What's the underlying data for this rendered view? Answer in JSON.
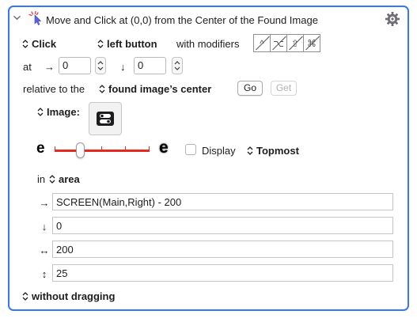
{
  "action": {
    "title": "Move and Click at (0,0) from the Center of the Found Image"
  },
  "click": {
    "type": "Click",
    "button": "left button",
    "modifiers_label": "with modifiers",
    "modifiers": [
      {
        "name": "control",
        "glyph": "^"
      },
      {
        "name": "option",
        "glyph": "⌥"
      },
      {
        "name": "shift",
        "glyph": "⇧"
      },
      {
        "name": "command",
        "glyph": "⌘"
      }
    ]
  },
  "position": {
    "at_label": "at",
    "x_arrow": "→",
    "x_value": "0",
    "y_arrow": "↓",
    "y_value": "0"
  },
  "relative": {
    "label": "relative to the",
    "anchor": "found image’s center",
    "go_label": "Go",
    "get_label": "Get"
  },
  "image": {
    "label": "Image:"
  },
  "fuzz": {
    "left_glyph": "e",
    "right_glyph": "e",
    "slider_fraction": 0.25,
    "display_label": "Display",
    "display_checked": false,
    "topmost_label": "Topmost"
  },
  "area": {
    "in_label": "in",
    "mode": "area",
    "rows": [
      {
        "icon": "→",
        "icon_name": "left-arrow-icon",
        "value": "SCREEN(Main,Right) - 200"
      },
      {
        "icon": "↓",
        "icon_name": "top-arrow-icon",
        "value": "0"
      },
      {
        "icon": "↔",
        "icon_name": "width-arrow-icon",
        "value": "200"
      },
      {
        "icon": "↕",
        "icon_name": "height-arrow-icon",
        "value": "25"
      }
    ]
  },
  "drag": {
    "mode": "without dragging"
  },
  "colors": {
    "accent": "#3478f6",
    "slider": "#e8291d"
  }
}
